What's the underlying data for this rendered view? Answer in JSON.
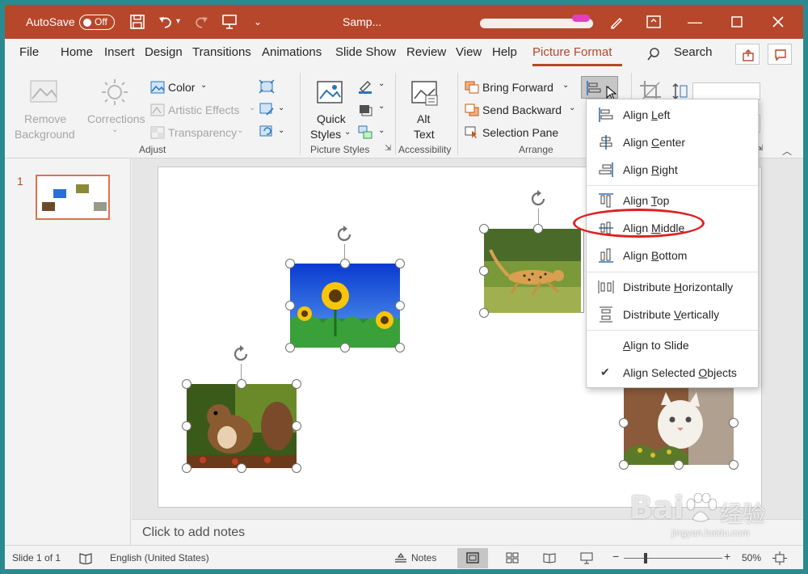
{
  "titlebar": {
    "autosave_label": "AutoSave",
    "autosave_state": "Off",
    "filename": "Samp...",
    "bg_color": "#b7472a"
  },
  "tabs": [
    "File",
    "Home",
    "Insert",
    "Design",
    "Transitions",
    "Animations",
    "Slide Show",
    "Review",
    "View",
    "Help",
    "Picture Format"
  ],
  "active_tab": "Picture Format",
  "search_label": "Search",
  "ribbon": {
    "remove_background": [
      "Remove",
      "Background"
    ],
    "corrections": "Corrections",
    "color": "Color",
    "artistic_effects": "Artistic Effects",
    "transparency": "Transparency",
    "adjust_group": "Adjust",
    "quick_styles": [
      "Quick",
      "Styles"
    ],
    "picture_styles_group": "Picture Styles",
    "alt_text": [
      "Alt",
      "Text"
    ],
    "accessibility_group": "Accessibility",
    "bring_forward": "Bring Forward",
    "send_backward": "Send Backward",
    "selection_pane": "Selection Pane",
    "arrange_group": "Arrange"
  },
  "slides": {
    "number": "1"
  },
  "align_menu": [
    {
      "label": "Align Left",
      "icon": "align-left-icon",
      "hotkey": "L"
    },
    {
      "label": "Align Center",
      "icon": "align-center-icon",
      "hotkey": "C"
    },
    {
      "label": "Align Right",
      "icon": "align-right-icon",
      "hotkey": "R"
    },
    {
      "label": "Align Top",
      "icon": "align-top-icon",
      "hotkey": "T"
    },
    {
      "label": "Align Middle",
      "icon": "align-middle-icon",
      "hotkey": "M",
      "highlighted": true
    },
    {
      "label": "Align Bottom",
      "icon": "align-bottom-icon",
      "hotkey": "B"
    },
    {
      "label": "Distribute Horizontally",
      "icon": "distribute-horizontally-icon",
      "hotkey": "H"
    },
    {
      "label": "Distribute Vertically",
      "icon": "distribute-vertically-icon",
      "hotkey": "V"
    },
    {
      "label": "Align to Slide",
      "icon": "",
      "hotkey": "A"
    },
    {
      "label": "Align Selected Objects",
      "icon": "check-icon",
      "hotkey": "O",
      "checked": true
    }
  ],
  "notes_placeholder": "Click to add notes",
  "status": {
    "slide_info": "Slide 1 of 1",
    "language": "English (United States)",
    "notes_button": "Notes",
    "zoom": "50%"
  },
  "watermark": {
    "brand": "Bai",
    "brand2": "经验",
    "url": "jingyan.baidu.com"
  },
  "colors": {
    "accent": "#b7472a",
    "highlight_circle": "#e02020"
  }
}
